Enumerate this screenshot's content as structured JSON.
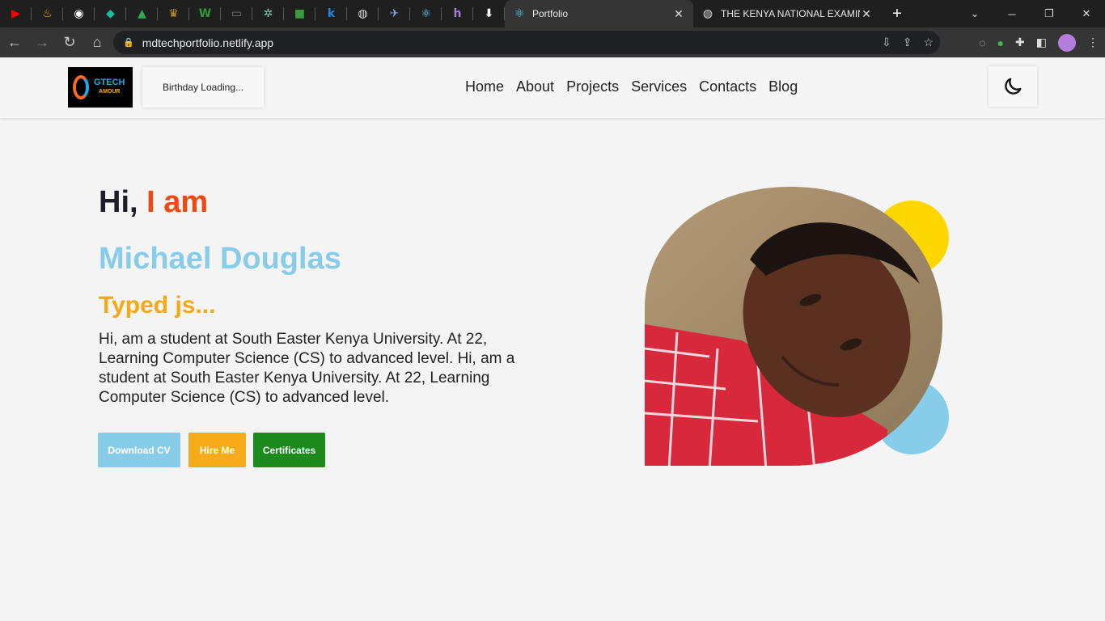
{
  "browser": {
    "pinned_tabs": [
      {
        "icon": "youtube-icon",
        "color": "#ff0000",
        "glyph": "▶"
      },
      {
        "icon": "flame-icon",
        "color": "#f5a623",
        "glyph": "♨"
      },
      {
        "icon": "github-icon",
        "color": "#ffffff",
        "glyph": "◉"
      },
      {
        "icon": "diamond-icon",
        "color": "#1abc9c",
        "glyph": "◆"
      },
      {
        "icon": "drive-icon",
        "color": "#34a853",
        "glyph": "▲"
      },
      {
        "icon": "crest-icon",
        "color": "#c49a2a",
        "glyph": "♛"
      },
      {
        "icon": "w-icon",
        "color": "#2e9b3a",
        "glyph": "W"
      },
      {
        "icon": "laptop-icon",
        "color": "#777777",
        "glyph": "▭"
      },
      {
        "icon": "openai-icon",
        "color": "#8ac7b3",
        "glyph": "✲"
      },
      {
        "icon": "green-square-icon",
        "color": "#3c9a3c",
        "glyph": "■"
      },
      {
        "icon": "k-icon",
        "color": "#1e88e5",
        "glyph": "k"
      },
      {
        "icon": "globe-icon",
        "color": "#dddddd",
        "glyph": "◍"
      },
      {
        "icon": "bird-icon",
        "color": "#7fa8d6",
        "glyph": "✈"
      },
      {
        "icon": "react-icon",
        "color": "#61dafb",
        "glyph": "⚛"
      },
      {
        "icon": "h-icon",
        "color": "#a77fd6",
        "glyph": "h"
      },
      {
        "icon": "download-icon",
        "color": "#ffffff",
        "glyph": "⬇"
      }
    ],
    "tabs": [
      {
        "title": "Portfolio",
        "active": true
      },
      {
        "title": "THE KENYA NATIONAL EXAMINATIONS",
        "active": false
      }
    ],
    "url": "mdtechportfolio.netlify.app"
  },
  "nav": {
    "logo_text": "GTECH",
    "logo_subtext": "AMOUR",
    "birthday": "Birthday Loading...",
    "links": [
      "Home",
      "About",
      "Projects",
      "Services",
      "Contacts",
      "Blog"
    ]
  },
  "hero": {
    "greeting_prefix": "Hi,",
    "greeting_accent": "I am",
    "name": "Michael Douglas",
    "typed": "Typed js...",
    "bio": "Hi, am a student at South Easter Kenya University. At 22, Learning Computer Science (CS) to advanced level. Hi, am a student at South Easter Kenya University. At 22, Learning Computer Science (CS) to advanced level.",
    "buttons": {
      "download": "Download CV",
      "hire": "Hire Me",
      "certificates": "Certificates"
    }
  },
  "colors": {
    "accent_orange": "#f0480f",
    "name_blue": "#87cdea",
    "typed_gold": "#f5a915",
    "circle_yellow": "#ffd700",
    "circle_blue": "#87cdea",
    "cert_green": "#1c8a1c"
  }
}
